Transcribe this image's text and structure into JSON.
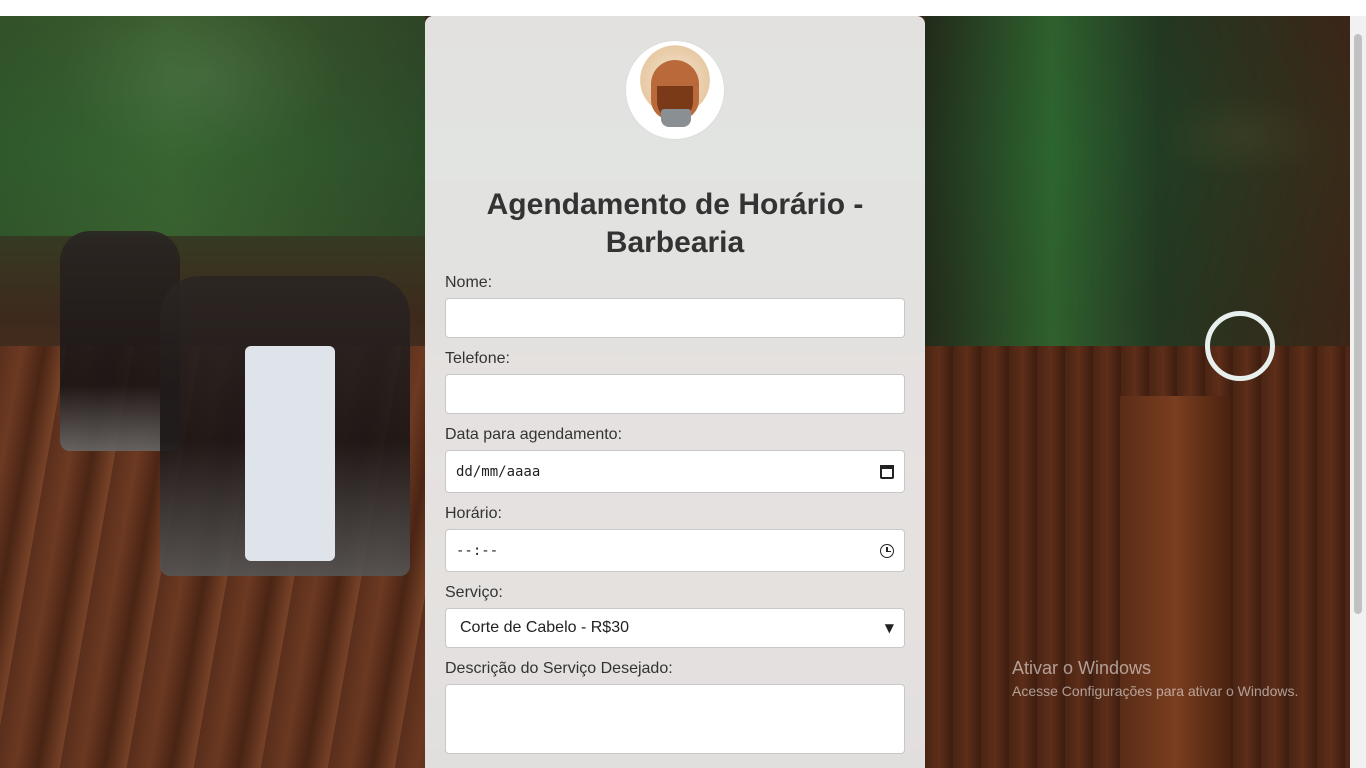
{
  "page": {
    "title": "Agendamento de Horário - Barbearia"
  },
  "form": {
    "nome": {
      "label": "Nome:",
      "value": ""
    },
    "telefone": {
      "label": "Telefone:",
      "value": ""
    },
    "data": {
      "label": "Data para agendamento:",
      "placeholder": "dd/mm/aaaa"
    },
    "horario": {
      "label": "Horário:",
      "placeholder": "--:--"
    },
    "servico": {
      "label": "Serviço:",
      "selected": "Corte de Cabelo - R$30"
    },
    "descricao": {
      "label": "Descrição do Serviço Desejado:",
      "value": ""
    }
  },
  "icons": {
    "logo": "barber-chef-logo-icon",
    "calendar": "calendar-icon",
    "clock": "clock-icon",
    "select_arrow": "chevron-down-icon"
  },
  "watermark": {
    "line1": "Ativar o Windows",
    "line2": "Acesse Configurações para ativar o Windows."
  },
  "colors": {
    "card_bg": "#f5f5f5",
    "title_text": "#333333",
    "input_border": "#c8c8c8"
  }
}
